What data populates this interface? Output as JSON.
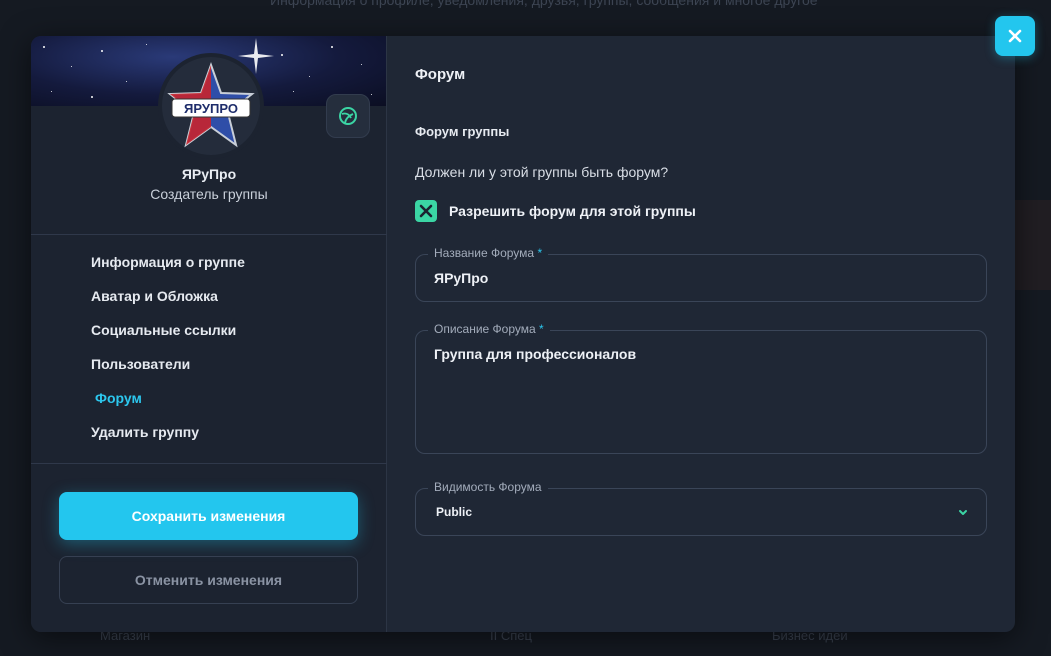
{
  "background": {
    "top_text": "Информация о профиле, уведомления, друзья, группы, сообщения и многое другое",
    "bottom_items": [
      "Магазин",
      "II Спец",
      "Бизнес идеи"
    ]
  },
  "sidebar": {
    "profile_name": "ЯРуПро",
    "profile_role": "Создатель группы",
    "avatar_text": "ЯРУПРО",
    "cover_button_icon": "change-cover-icon",
    "nav": [
      {
        "label": "Информация о группе",
        "active": false
      },
      {
        "label": "Аватар и Обложка",
        "active": false
      },
      {
        "label": "Социальные ссылки",
        "active": false
      },
      {
        "label": "Пользователи",
        "active": false
      },
      {
        "label": "Форум",
        "active": true
      },
      {
        "label": "Удалить группу",
        "active": false
      }
    ],
    "save_label": "Сохранить изменения",
    "cancel_label": "Отменить изменения"
  },
  "main": {
    "section_title": "Форум",
    "sub_title": "Форум группы",
    "question": "Должен ли у этой группы быть форум?",
    "checkbox": {
      "label": "Разрешить форум для этой группы",
      "checked": true
    },
    "forum_name": {
      "label": "Название Форума",
      "required": "*",
      "value": "ЯРуПро"
    },
    "forum_description": {
      "label": "Описание Форума",
      "required": "*",
      "value": "Группа для профессионалов"
    },
    "forum_visibility": {
      "label": "Видимость Форума",
      "value": "Public"
    }
  },
  "colors": {
    "accent": "#23c6ee",
    "check": "#3bd5a4",
    "modal_bg": "#1f2735",
    "sidebar_bg": "#1c2330"
  }
}
